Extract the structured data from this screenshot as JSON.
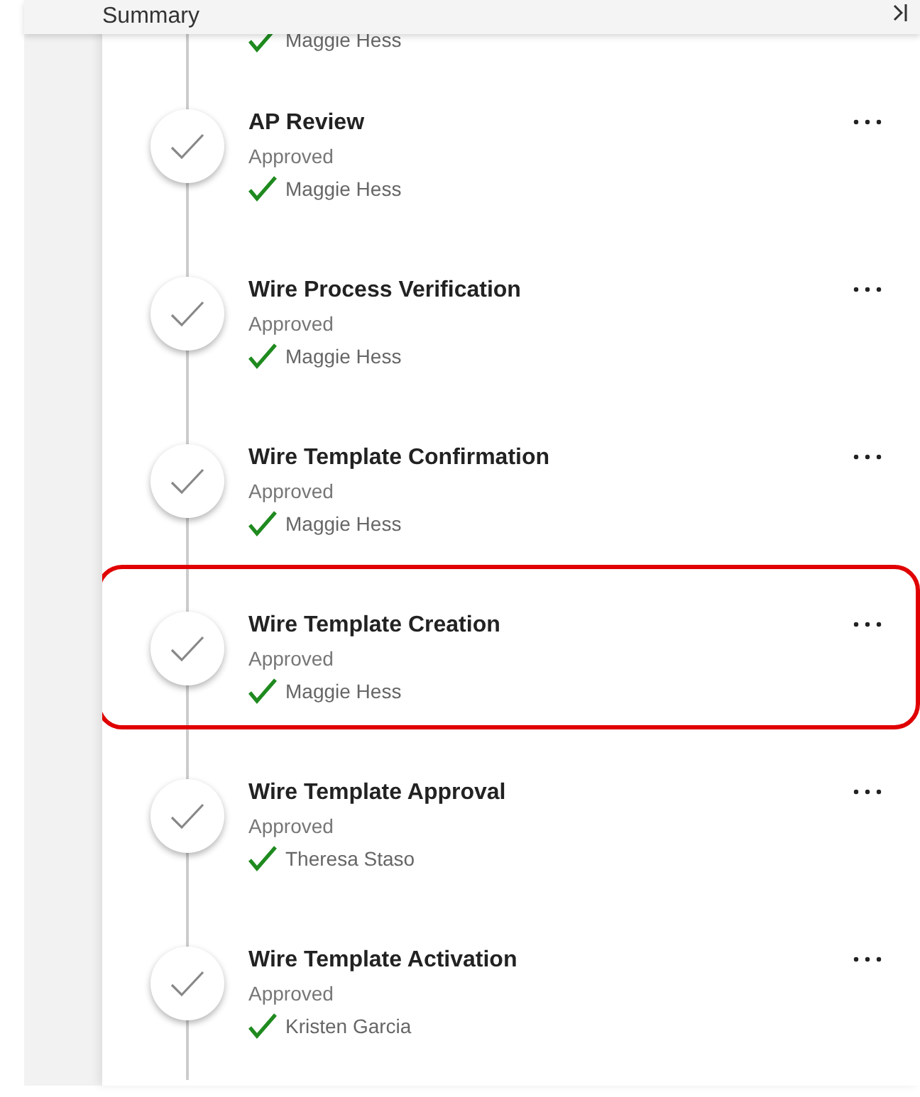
{
  "header": {
    "title": "Summary"
  },
  "partial_step": {
    "approver": "Maggie Hess"
  },
  "steps": [
    {
      "title": "AP Review",
      "status": "Approved",
      "approver": "Maggie Hess",
      "highlighted": false
    },
    {
      "title": "Wire Process Verification",
      "status": "Approved",
      "approver": "Maggie Hess",
      "highlighted": false
    },
    {
      "title": "Wire Template Confirmation",
      "status": "Approved",
      "approver": "Maggie Hess",
      "highlighted": false
    },
    {
      "title": "Wire Template Creation",
      "status": "Approved",
      "approver": "Maggie Hess",
      "highlighted": true
    },
    {
      "title": "Wire Template Approval",
      "status": "Approved",
      "approver": "Theresa Staso",
      "highlighted": false
    },
    {
      "title": "Wire Template Activation",
      "status": "Approved",
      "approver": "Kristen Garcia",
      "highlighted": false
    }
  ]
}
